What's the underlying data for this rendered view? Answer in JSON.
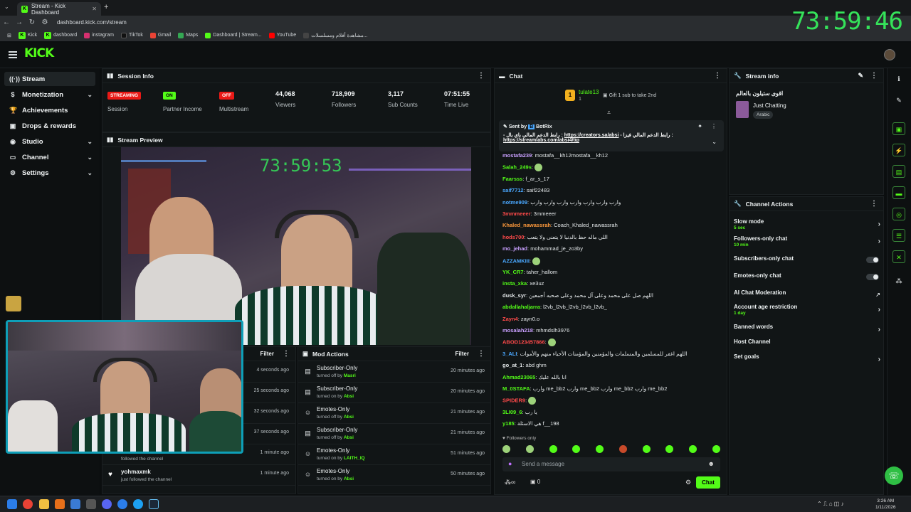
{
  "browser": {
    "tab_title": "Stream - Kick Dashboard",
    "url": "dashboard.kick.com/stream",
    "bookmarks": [
      "Kick",
      "dashboard",
      "instagram",
      "TikTok",
      "Gmail",
      "Maps",
      "Dashboard | Stream...",
      "YouTube",
      "مشاهدة أفلام ومسلسلات..."
    ]
  },
  "overlay_timer": "73:59:46",
  "preview_timer": "73:59:53",
  "app": {
    "logo": "KICK"
  },
  "sidebar": {
    "items": [
      {
        "label": "Stream",
        "icon": "broadcast-icon"
      },
      {
        "label": "Monetization",
        "icon": "dollar-icon"
      },
      {
        "label": "Achievements",
        "icon": "trophy-icon"
      },
      {
        "label": "Drops & rewards",
        "icon": "gift-icon"
      },
      {
        "label": "Studio",
        "icon": "studio-icon"
      },
      {
        "label": "Channel",
        "icon": "channel-icon"
      },
      {
        "label": "Settings",
        "icon": "gear-icon"
      }
    ]
  },
  "session": {
    "title": "Session Info",
    "badges": {
      "streaming": "STREAMING",
      "partner": "ON",
      "multistream": "OFF"
    },
    "labels": {
      "session": "Session",
      "partner": "Partner Income",
      "multistream": "Multistream",
      "viewers": "Viewers",
      "followers": "Followers",
      "subs": "Sub Counts",
      "time": "Time Live"
    },
    "values": {
      "viewers": "44,068",
      "followers": "718,909",
      "subs": "3,117",
      "time": "07:51:55"
    }
  },
  "preview": {
    "title": "Stream Preview"
  },
  "activity": {
    "filter": "Filter",
    "times": [
      "4 seconds ago",
      "25 seconds ago",
      "32 seconds ago",
      "37 seconds ago",
      "1 minute ago",
      "1 minute ago"
    ],
    "last_user": "yohmaxmk",
    "followed": "just followed the channel",
    "followed_partial": "followed the channel"
  },
  "mod_actions": {
    "title": "Mod Actions",
    "filter": "Filter",
    "rows": [
      {
        "action": "Subscriber-Only",
        "sub": "turned off by",
        "user": "Masri",
        "time": "20 minutes ago"
      },
      {
        "action": "Subscriber-Only",
        "sub": "turned on by",
        "user": "Absi",
        "time": "20 minutes ago"
      },
      {
        "action": "Emotes-Only",
        "sub": "turned off by",
        "user": "Absi",
        "time": "21 minutes ago"
      },
      {
        "action": "Subscriber-Only",
        "sub": "turned off by",
        "user": "Absi",
        "time": "21 minutes ago"
      },
      {
        "action": "Emotes-Only",
        "sub": "turned on by",
        "user": "LAITH_IQ",
        "time": "51 minutes ago"
      },
      {
        "action": "Emotes-Only",
        "sub": "turned on by",
        "user": "Absi",
        "time": "50 minutes ago"
      }
    ]
  },
  "chat": {
    "title": "Chat",
    "gift_user": "tulate13",
    "gift_count": "1",
    "gift_text": "Gift 1 sub to take 2nd",
    "pinned": {
      "sent_by": "Sent by",
      "bot": "BotRix",
      "text": "- رابط الدعم المالي باي بال :",
      "link1": "https://creators.sa/absi",
      "text2": "- رابط الدعم المالي فيزا :",
      "link2": "https://streamlabs.com/absi4/tip"
    },
    "messages": [
      {
        "user": "mostafa239",
        "text": "mostafa__kh12mostafa__kh12",
        "color": "#c9a0ff"
      },
      {
        "user": "Salah_249s",
        "text": "",
        "color": "#53fc18",
        "emote": true
      },
      {
        "user": "Faarsss",
        "text": "f_ar_s_17",
        "color": "#53fc18"
      },
      {
        "user": "saif7712",
        "text": "saif22483",
        "color": "#4aa8ff"
      },
      {
        "user": "notme909",
        "text": "وارب وارب وارب وارب وارب وارب وارب",
        "color": "#4aa8ff"
      },
      {
        "user": "3mmmeeer",
        "text": "3mmeeer",
        "color": "#ff4a4a"
      },
      {
        "user": "Khaled_nawassrah",
        "text": "Coach_Khaled_nawassrah",
        "color": "#ff9a3c"
      },
      {
        "user": "hods700",
        "text": "اللي ماله حظ بالدنيا لا يتعنى ولا يتعب",
        "color": "#ff4a4a"
      },
      {
        "user": "mo_jehad",
        "text": "mohammad_je_zo3by",
        "color": "#c9a0ff"
      },
      {
        "user": "AZZAMKIII",
        "text": "",
        "color": "#4aa8ff",
        "emote": true
      },
      {
        "user": "YK_CR7",
        "text": "taher_hallom",
        "color": "#53fc18"
      },
      {
        "user": "insta_xka",
        "text": "xe3uz",
        "color": "#53fc18"
      },
      {
        "user": "dusk_syr",
        "text": "اللهم صل على محمد وعلى آل محمد وعلى صحبه أجمعين",
        "color": "#e4e8ea"
      },
      {
        "user": "abdallahaljarra",
        "text": "l2vb_l2vb_l2vb_l2vb_l2vb_",
        "color": "#53fc18"
      },
      {
        "user": "Zayn4",
        "text": "zayn0.o",
        "color": "#ff4a4a"
      },
      {
        "user": "mosalah218",
        "text": "mhmdslh3976",
        "color": "#c9a0ff"
      },
      {
        "user": "ABOD123457866",
        "text": "",
        "color": "#ff4a4a",
        "emote": true
      },
      {
        "user": "3_ALI",
        "text": "اللهم اغفر للمسلمين والمسلمات والمؤمنين والمؤمنات الأحياء منهم والأموات",
        "color": "#4aa8ff"
      },
      {
        "user": "go_at_1",
        "text": "abd ghm",
        "color": "#e4e8ea"
      },
      {
        "user": "Ahmad23065",
        "text": "انا بالله عليك",
        "color": "#53fc18"
      },
      {
        "user": "M_0STAFA",
        "text": "وارب me_bb2 وارب me_bb2 وارب me_bb2 وارب me_bb2",
        "color": "#53fc18"
      },
      {
        "user": "SPIDER9",
        "text": "",
        "color": "#ff4a4a",
        "emote": true
      },
      {
        "user": "3LI09_6",
        "text": "يا رب",
        "color": "#53fc18"
      },
      {
        "user": "y185",
        "text": "هي الاسئلة f__198",
        "color": "#53fc18"
      }
    ],
    "followers_only": "Followers only",
    "input_placeholder": "Send a message",
    "count": "0",
    "send": "Chat"
  },
  "stream_info": {
    "title": "Stream info",
    "stream_title": "اقوى ستيلون بالعالم",
    "category": "Just Chatting",
    "tag": "Arabic"
  },
  "channel_actions": {
    "title": "Channel Actions",
    "rows": [
      {
        "label": "Slow mode",
        "sub": "5 sec",
        "ctrl": "chevron"
      },
      {
        "label": "Followers-only chat",
        "sub": "10 min",
        "ctrl": "chevron"
      },
      {
        "label": "Subscribers-only chat",
        "sub": "",
        "ctrl": "toggle"
      },
      {
        "label": "Emotes-only chat",
        "sub": "",
        "ctrl": "toggle"
      },
      {
        "label": "AI Chat Moderation",
        "sub": "",
        "ctrl": "external"
      },
      {
        "label": "Account age restriction",
        "sub": "1 day",
        "ctrl": "chevron"
      },
      {
        "label": "Banned words",
        "sub": "",
        "ctrl": "chevron"
      },
      {
        "label": "Host Channel",
        "sub": "",
        "ctrl": "none"
      },
      {
        "label": "Set goals",
        "sub": "",
        "ctrl": "chevron"
      }
    ]
  },
  "taskbar": {
    "time": "3:26 AM",
    "date": "1/11/2026"
  },
  "colors": {
    "brand": "#53fc18",
    "live_red": "#e91916",
    "bg": "#0b0e0f",
    "panel": "#111516"
  }
}
